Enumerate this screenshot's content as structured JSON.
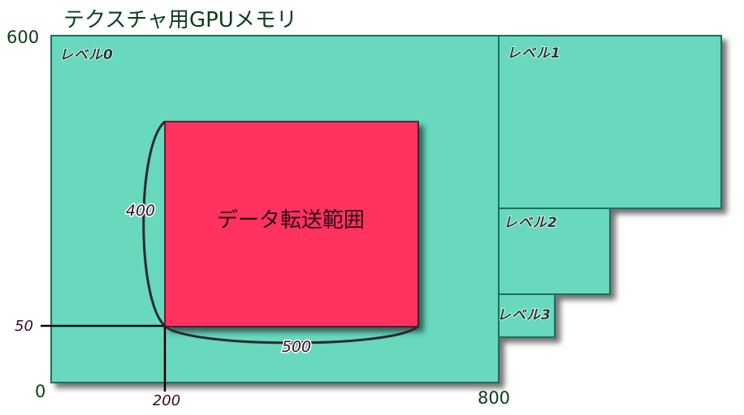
{
  "title": "テクスチャ用GPUメモリ",
  "axis": {
    "y_top": "600",
    "y_mid": "50",
    "origin": "0",
    "x_mid": "200",
    "x_right": "800"
  },
  "levels": [
    "レベル0",
    "レベル1",
    "レベル2",
    "レベル3"
  ],
  "transfer": {
    "label": "データ転送範囲",
    "height_label": "400",
    "width_label": "500"
  },
  "colors": {
    "block_fill": "#68d8be",
    "block_stroke": "#1f6e62",
    "transfer_fill": "#ff3060",
    "title_text": "#0b3d1a"
  }
}
